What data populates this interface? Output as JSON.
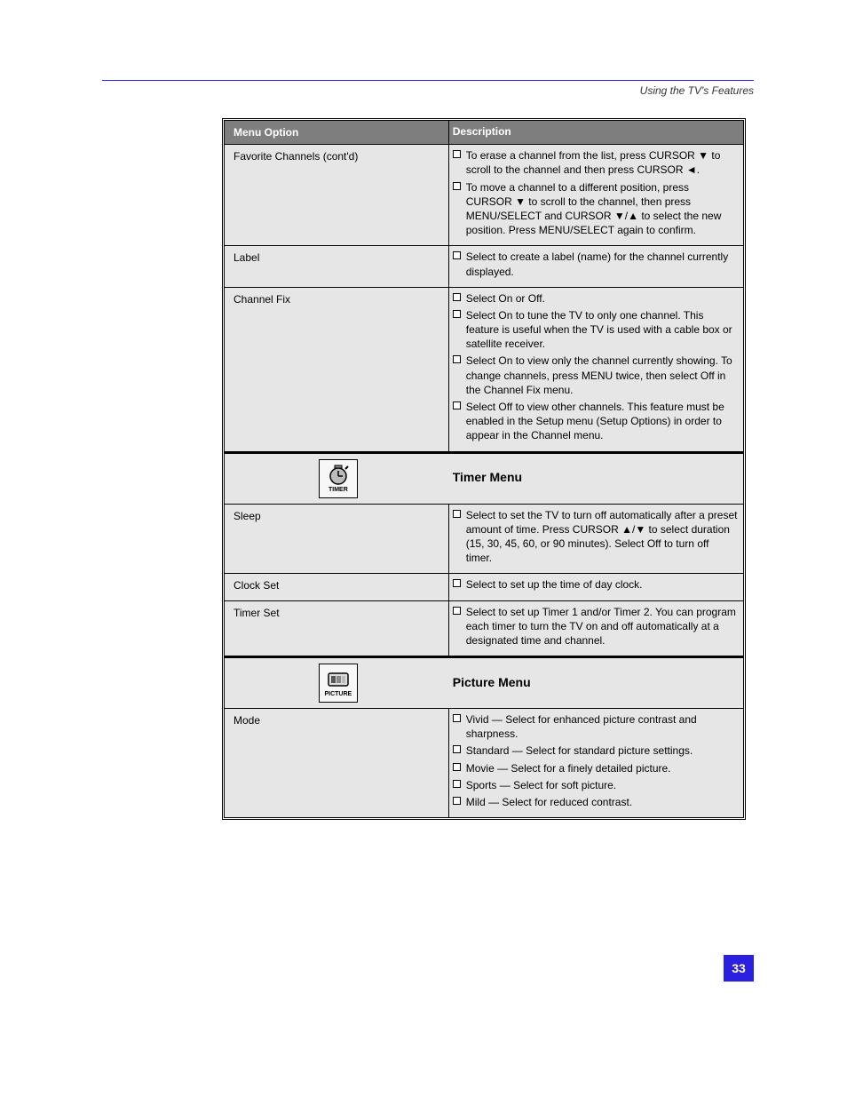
{
  "header": {
    "breadcrumb": "Using the TV's Features"
  },
  "table": {
    "header": {
      "col1": "Menu Option",
      "col2": "Description"
    },
    "rows": [
      {
        "label": "Favorite Channels (cont'd)",
        "items": [
          "To erase a channel from the list, press CURSOR ▼ to scroll to the channel and then press CURSOR ◄.",
          "To move a channel to a different position, press CURSOR ▼ to scroll to the channel, then press MENU/SELECT and CURSOR ▼/▲ to select the new position. Press MENU/SELECT again to confirm."
        ]
      },
      {
        "label": "Label",
        "items": [
          "Select to create a label (name) for the channel currently displayed."
        ]
      },
      {
        "label": "Channel Fix",
        "items": [
          "Select On or Off.",
          "Select On to tune the TV to only one channel. This feature is useful when the TV is used with a cable box or satellite receiver.",
          "Select On to view only the channel currently showing. To change channels, press MENU twice, then select Off in the Channel Fix menu.",
          "Select Off to view other channels. This feature must be enabled in the Setup menu (Setup Options) in order to appear in the Channel menu."
        ]
      }
    ],
    "sections": [
      {
        "icon": "timer",
        "title": "Timer Menu",
        "rows": [
          {
            "label": "Sleep",
            "items": [
              "Select to set the TV to turn off automatically after a preset amount of time. Press CURSOR ▲/▼ to select duration (15, 30, 45, 60, or 90 minutes). Select Off to turn off timer."
            ]
          },
          {
            "label": "Clock Set",
            "items": [
              "Select to set up the time of day clock."
            ]
          },
          {
            "label": "Timer Set",
            "items": [
              "Select to set up Timer 1 and/or Timer 2. You can program each timer to turn the TV on and off automatically at a designated time and channel."
            ]
          }
        ]
      },
      {
        "icon": "picture",
        "title": "Picture Menu",
        "rows": [
          {
            "label": "Mode",
            "items": [
              "Vivid — Select for enhanced picture contrast and sharpness.",
              "Standard — Select for standard picture settings.",
              "Movie — Select for a finely detailed picture.",
              "Sports — Select for soft picture.",
              "Mild — Select for reduced contrast."
            ]
          }
        ]
      }
    ]
  },
  "pageNumber": "33"
}
